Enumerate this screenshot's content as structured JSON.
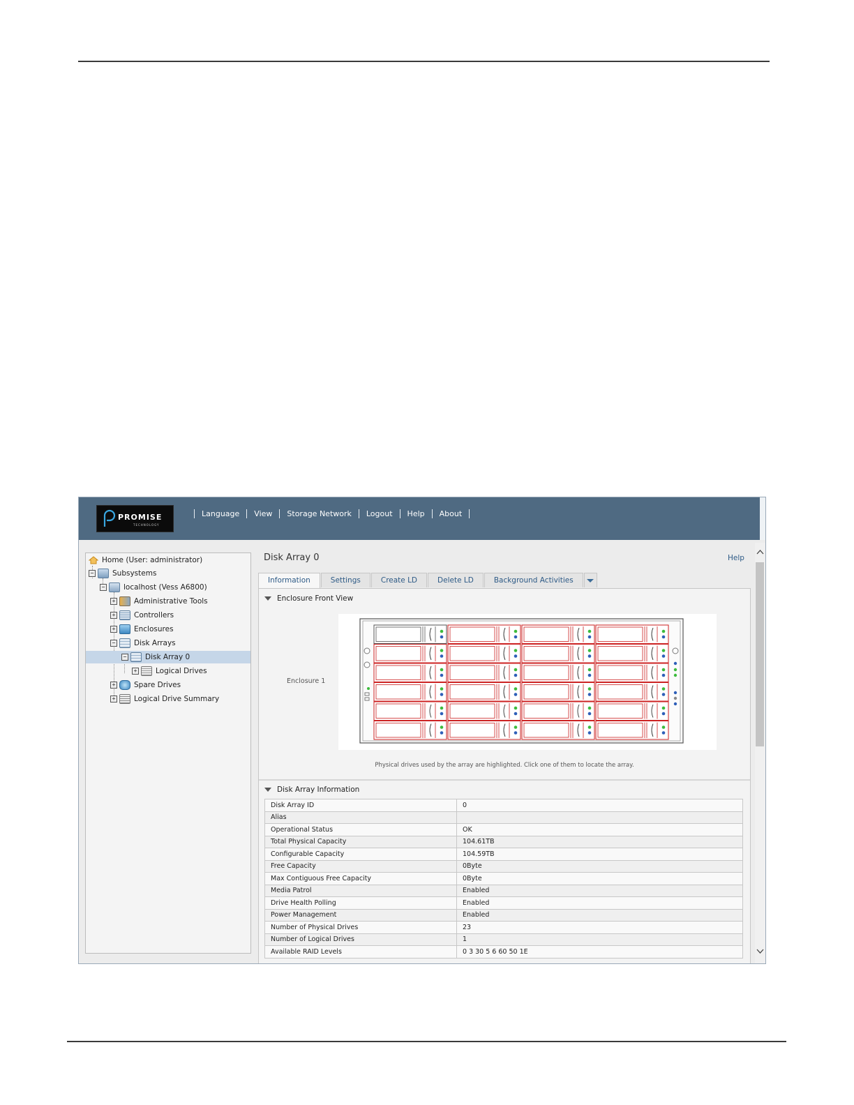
{
  "logo": {
    "name": "PROMISE",
    "sub": "TECHNOLOGY"
  },
  "nav": [
    "Language",
    "View",
    "Storage Network",
    "Logout",
    "Help",
    "About"
  ],
  "tree": [
    {
      "label": "Home (User: administrator)",
      "icon": "home-icon"
    },
    {
      "label": "Subsystems",
      "icon": "subsystems-icon"
    },
    {
      "label": "localhost (Vess A6800)",
      "icon": "server-icon"
    },
    {
      "label": "Administrative Tools",
      "icon": "tools-icon"
    },
    {
      "label": "Controllers",
      "icon": "controller-icon"
    },
    {
      "label": "Enclosures",
      "icon": "enclosure-icon"
    },
    {
      "label": "Disk Arrays",
      "icon": "disk-array-icon"
    },
    {
      "label": "Disk Array 0",
      "icon": "disk-array-icon",
      "selected": true
    },
    {
      "label": "Logical Drives",
      "icon": "logical-drive-icon"
    },
    {
      "label": "Spare Drives",
      "icon": "spare-drive-icon"
    },
    {
      "label": "Logical Drive Summary",
      "icon": "summary-icon"
    }
  ],
  "page": {
    "title": "Disk Array 0",
    "help": "Help"
  },
  "tabs": [
    "Information",
    "Settings",
    "Create LD",
    "Delete LD",
    "Background Activities"
  ],
  "enclosure_section": {
    "title": "Enclosure Front View",
    "label": "Enclosure 1",
    "caption": "Physical drives used by the array are highlighted. Click one of them to locate the array.",
    "drive_grid": {
      "rows": 6,
      "cols": 4,
      "empty_slot": [
        0,
        0
      ]
    }
  },
  "info_section": {
    "title": "Disk Array Information",
    "rows": [
      [
        "Disk Array ID",
        "0"
      ],
      [
        "Alias",
        ""
      ],
      [
        "Operational Status",
        "OK"
      ],
      [
        "Total Physical Capacity",
        "104.61TB"
      ],
      [
        "Configurable Capacity",
        "104.59TB"
      ],
      [
        "Free Capacity",
        "0Byte"
      ],
      [
        "Max Contiguous Free Capacity",
        "0Byte"
      ],
      [
        "Media Patrol",
        "Enabled"
      ],
      [
        "Drive Health Polling",
        "Enabled"
      ],
      [
        "Power Management",
        "Enabled"
      ],
      [
        "Number of Physical Drives",
        "23"
      ],
      [
        "Number of Logical Drives",
        "1"
      ],
      [
        "Available RAID Levels",
        "0 3 30 5 6 60 50 1E"
      ]
    ]
  },
  "colors": {
    "header": "#4f6a82",
    "link": "#2d5a86",
    "selected": "#c5d6e8",
    "drive_highlight": "#cc2222"
  }
}
